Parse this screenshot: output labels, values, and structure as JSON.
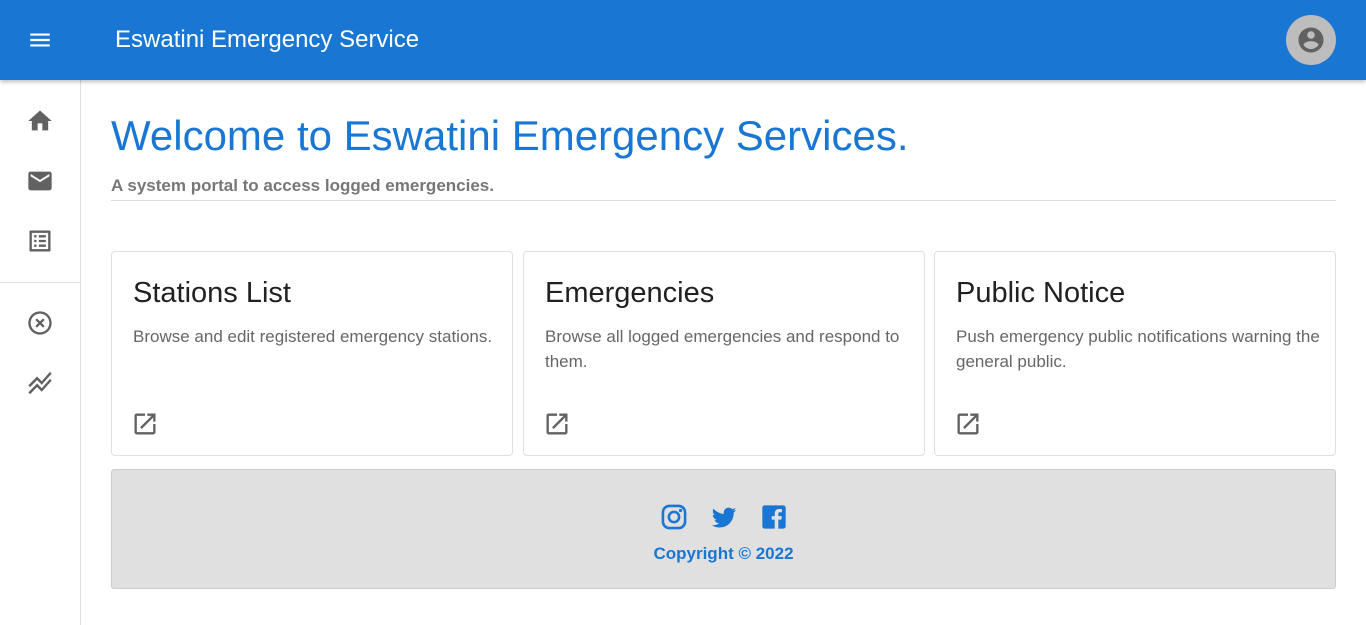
{
  "appbar": {
    "title": "Eswatini Emergency Service",
    "menu_icon": "menu-icon",
    "account_icon": "account-circle-icon",
    "bg_color": "#1976d2"
  },
  "drawer": {
    "items": [
      {
        "name": "home",
        "icon": "home-icon"
      },
      {
        "name": "mail",
        "icon": "mail-icon"
      },
      {
        "name": "list",
        "icon": "list-alt-icon"
      },
      {
        "name": "cancel",
        "icon": "cancel-circle-icon"
      },
      {
        "name": "stacked-line",
        "icon": "stacked-line-chart-icon"
      }
    ]
  },
  "main": {
    "welcome": "Welcome to Eswatini Emergency Services.",
    "subtitle": "A system portal to access logged emergencies.",
    "cards": [
      {
        "title": "Stations List",
        "text": "Browse and edit registered emergency stations.",
        "icon": "open-in-new-icon"
      },
      {
        "title": "Emergencies",
        "text": "Browse all logged emergencies and respond to them.",
        "icon": "open-in-new-icon"
      },
      {
        "title": "Public Notice",
        "text": "Push emergency public notifications warning the general public.",
        "icon": "open-in-new-icon"
      }
    ]
  },
  "footer": {
    "social": [
      "instagram-icon",
      "twitter-icon",
      "facebook-icon"
    ],
    "copyright": "Copyright © 2022",
    "accent": "#1976d2"
  }
}
